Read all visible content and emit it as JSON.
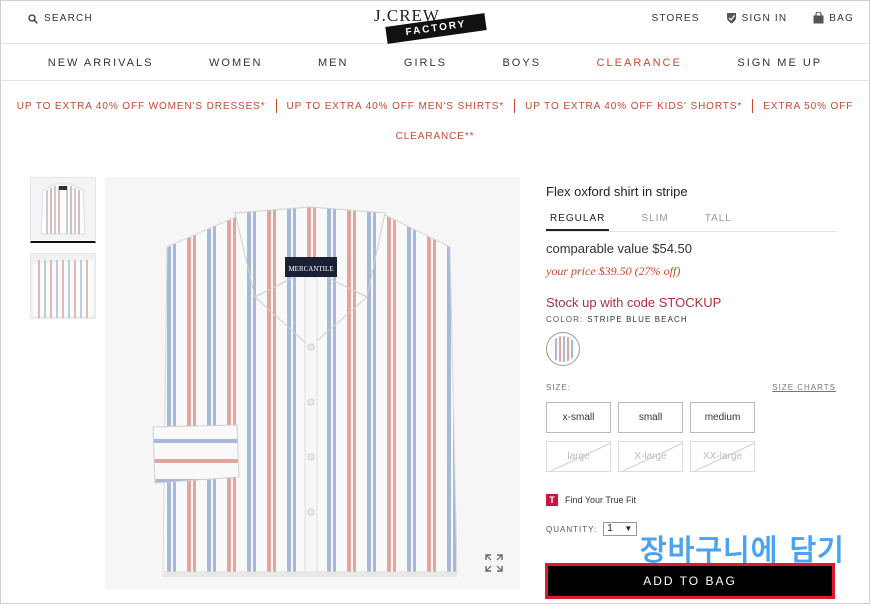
{
  "header": {
    "search_label": "SEARCH",
    "logo_top": "J.CREW",
    "logo_bottom": "FACTORY",
    "stores_label": "STORES",
    "signin_label": "SIGN IN",
    "bag_label": "BAG"
  },
  "nav": {
    "items": [
      "NEW ARRIVALS",
      "WOMEN",
      "MEN",
      "GIRLS",
      "BOYS",
      "CLEARANCE",
      "SIGN ME UP"
    ]
  },
  "promo": {
    "items": [
      "UP TO EXTRA 40% OFF WOMEN'S DRESSES*",
      "UP TO EXTRA 40% OFF MEN'S SHIRTS*",
      "UP TO EXTRA 40% OFF KIDS' SHORTS*",
      "EXTRA 50% OFF",
      "CLEARANCE**"
    ],
    "color": "#c8482e"
  },
  "image": {
    "label": "MERCANTILE"
  },
  "product": {
    "title": "Flex oxford shirt in stripe",
    "fits": [
      "REGULAR",
      "SLIM",
      "TALL"
    ],
    "comparable": "comparable value $54.50",
    "your_price": "your price $39.50 (27% off)",
    "code": "Stock up with code STOCKUP",
    "color_label": "COLOR:",
    "color_value": "STRIPE BLUE BEACH",
    "size_label": "SIZE:",
    "size_charts": "SIZE CHARTS",
    "sizes": [
      "x-small",
      "small",
      "medium",
      "large",
      "X-large",
      "XX-large"
    ],
    "truefit_badge": "T",
    "truefit": "Find Your True Fit",
    "quantity_label": "QUANTITY:",
    "quantity": "1",
    "add_to_bag": "ADD TO BAG"
  },
  "overlay": {
    "korean": "장바구니에 담기",
    "highlight_color": "#e0192b",
    "text_color": "#4aa3f0"
  }
}
